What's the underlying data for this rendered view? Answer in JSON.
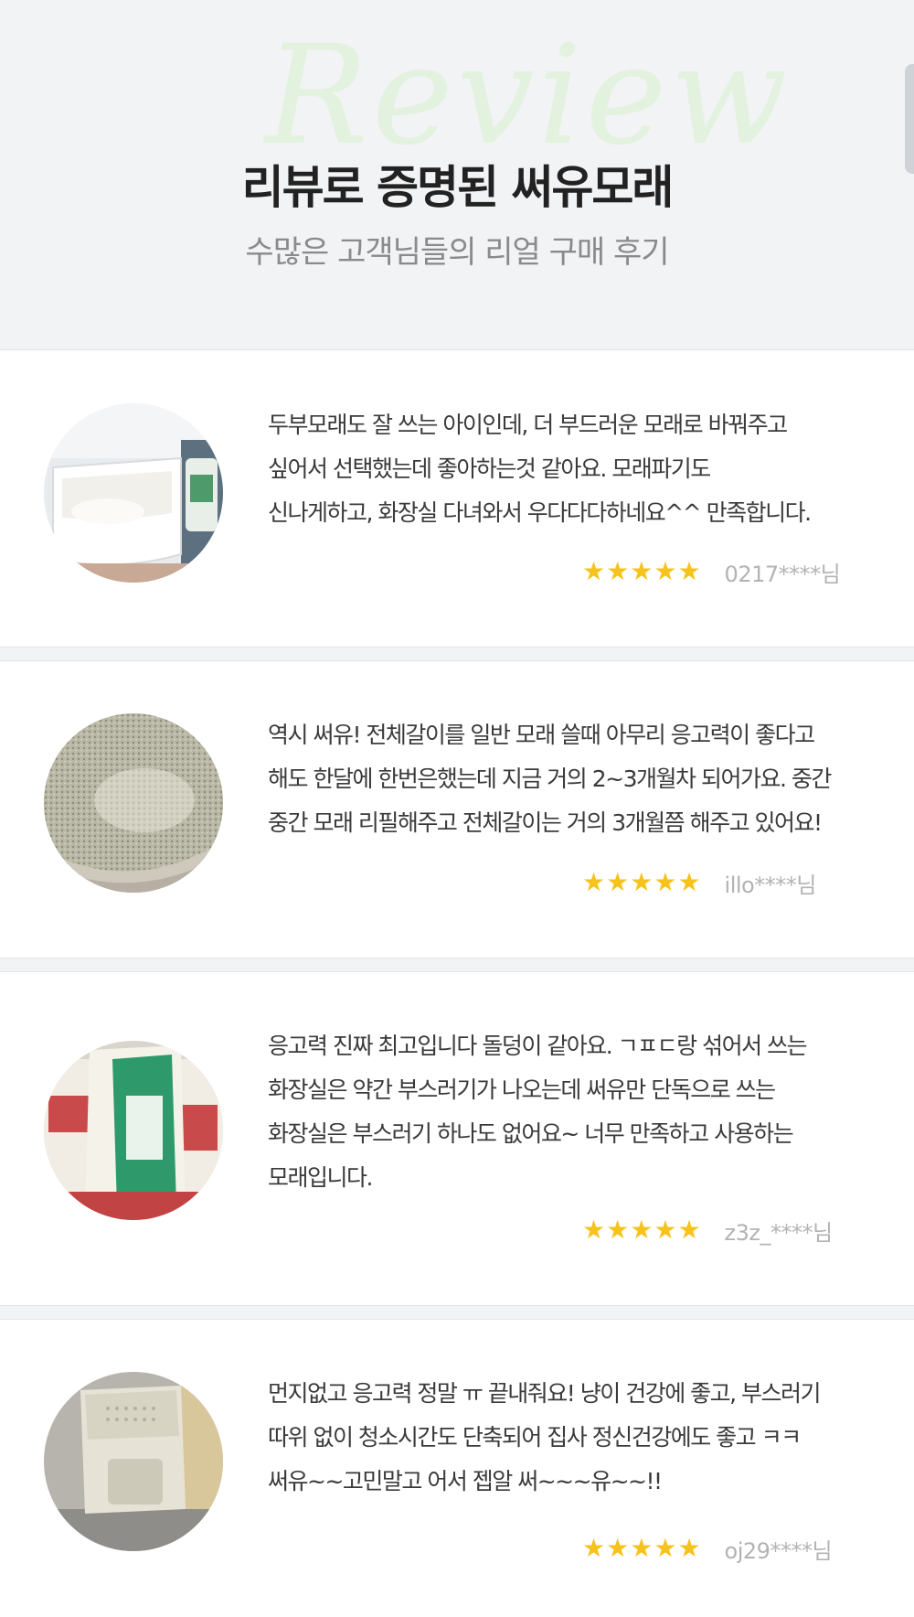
{
  "header": {
    "watermark": "Review",
    "title": "리뷰로 증명된 써유모래",
    "subtitle": "수많은 고객님들의 리얼 구매 후기"
  },
  "colors": {
    "background": "#f2f3f5",
    "card": "#ffffff",
    "star": "#f6c31c",
    "user": "#b3b3b3",
    "watermark": "#e3f1df"
  },
  "reviews": [
    {
      "text": "두부모래도 잘 쓰는 아이인데, 더 부드러운 모래로 바꿔주고\n싶어서 선택했는데 좋아하는것 같아요. 모래파기도\n신나게하고, 화장실 다녀와서 우다다다하네요^^ 만족합니다.",
      "rating": 5,
      "stars": [
        "★",
        "★",
        "★",
        "★",
        "★"
      ],
      "user": "0217****님",
      "photo": "litter-box-white-photo"
    },
    {
      "text": "역시 써유! 전체갈이를 일반 모래 쓸때 아무리 응고력이 좋다고\n해도 한달에 한번은했는데 지금 거의 2~3개월차 되어가요. 중간\n중간 모래 리필해주고 전체갈이는 거의 3개월쯤 해주고 있어요!",
      "rating": 5,
      "stars": [
        "★",
        "★",
        "★",
        "★",
        "★"
      ],
      "user": "illo****님",
      "photo": "litter-closeup-photo"
    },
    {
      "text": "응고력 진짜 최고입니다 돌덩이 같아요. ㄱㅍㄷ랑 섞어서 쓰는\n화장실은 약간 부스러기가 나오는데 써유만 단독으로 쓰는\n화장실은 부스러기 하나도 없어요~ 너무 만족하고 사용하는\n모래입니다.",
      "rating": 5,
      "stars": [
        "★",
        "★",
        "★",
        "★",
        "★"
      ],
      "user": "z3z_****님",
      "photo": "product-bags-photo"
    },
    {
      "text": "먼지없고 응고력 정말 ㅠ 끝내줘요! 냥이 건강에 좋고, 부스러기\n따위 없이 청소시간도 단축되어 집사 정신건강에도 좋고 ㅋㅋ\n써유~~고민말고 어서 젭알 써~~~유~~!!",
      "rating": 5,
      "stars": [
        "★",
        "★",
        "★",
        "★",
        "★"
      ],
      "user": "oj29****님",
      "photo": "covered-litter-box-photo"
    }
  ]
}
